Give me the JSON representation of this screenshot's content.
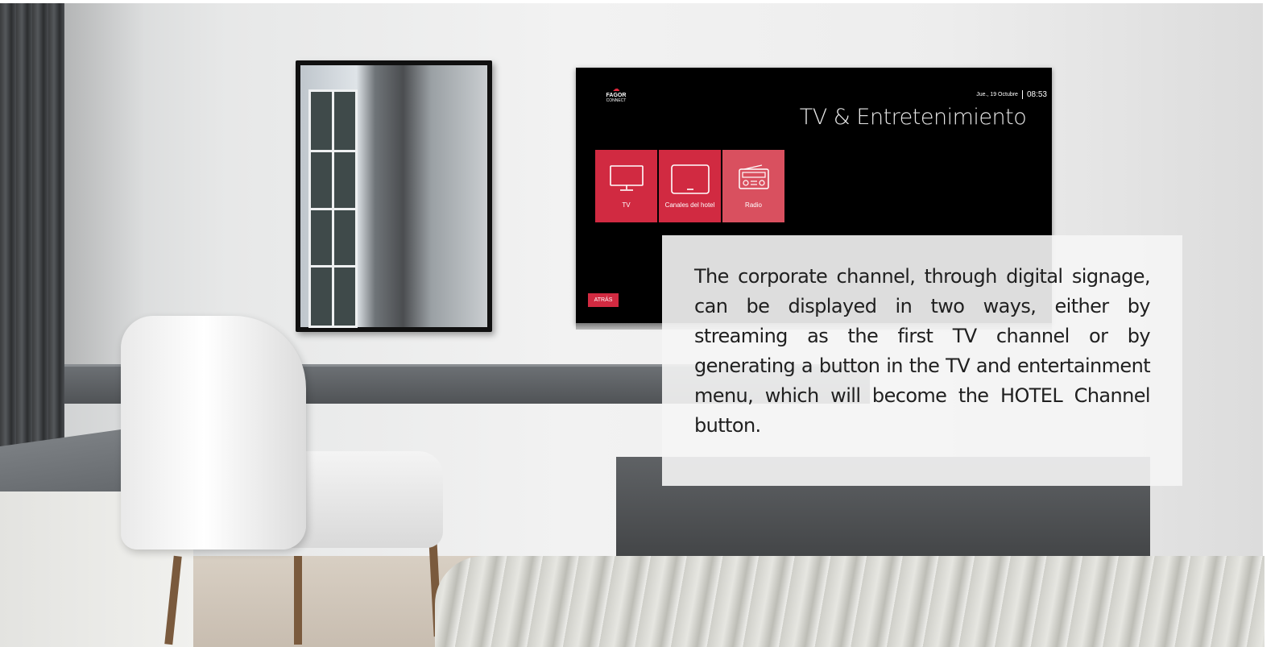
{
  "tv_screen": {
    "logo": {
      "brand": "FAGOR",
      "sub": "CONNECT"
    },
    "date": "Jue., 19 Octubre",
    "time": "08:53",
    "title": "TV & Entretenimiento",
    "tiles": [
      {
        "label": "TV",
        "icon": "monitor-icon",
        "color": "#d12a41"
      },
      {
        "label": "Canales del hotel",
        "icon": "tv-screen-icon",
        "color": "#d12a41"
      },
      {
        "label": "Radio",
        "icon": "radio-icon",
        "color": "#d9505f"
      }
    ],
    "back_label": "ATRÁS"
  },
  "caption": {
    "text": "The corporate channel, through digital signage, can be displayed in two ways, either by streaming as the first TV channel or by generating a button in the TV and entertainment menu, which will become the HOTEL Channel button."
  },
  "colors": {
    "accent": "#d12a41",
    "tv_background": "#000000",
    "panel_background": "#f5f5f5"
  }
}
